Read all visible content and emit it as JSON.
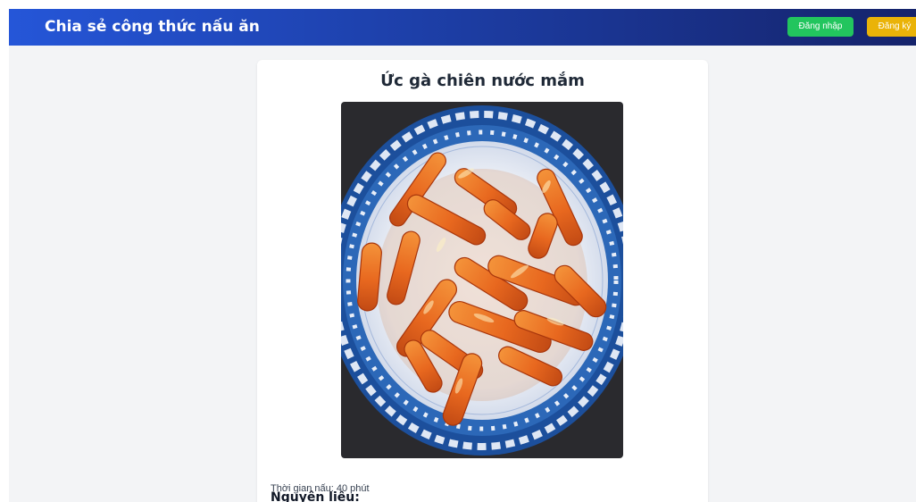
{
  "navbar": {
    "brand": "Chia sẻ công thức nấu ăn",
    "login_label": "Đăng nhập",
    "register_label": "Đăng ký"
  },
  "recipe": {
    "title": "Ức gà chiên nước mắm",
    "image_alt": "Ức gà chiên nước mắm",
    "cook_time": "Thời gian nấu: 40 phút",
    "ingredients_heading": "Nguyên liệu:"
  },
  "colors": {
    "navbar_start": "#2556d8",
    "navbar_end": "#15236b",
    "login_button": "#22c55e",
    "register_button": "#eab308",
    "page_background": "#f3f4f6"
  }
}
